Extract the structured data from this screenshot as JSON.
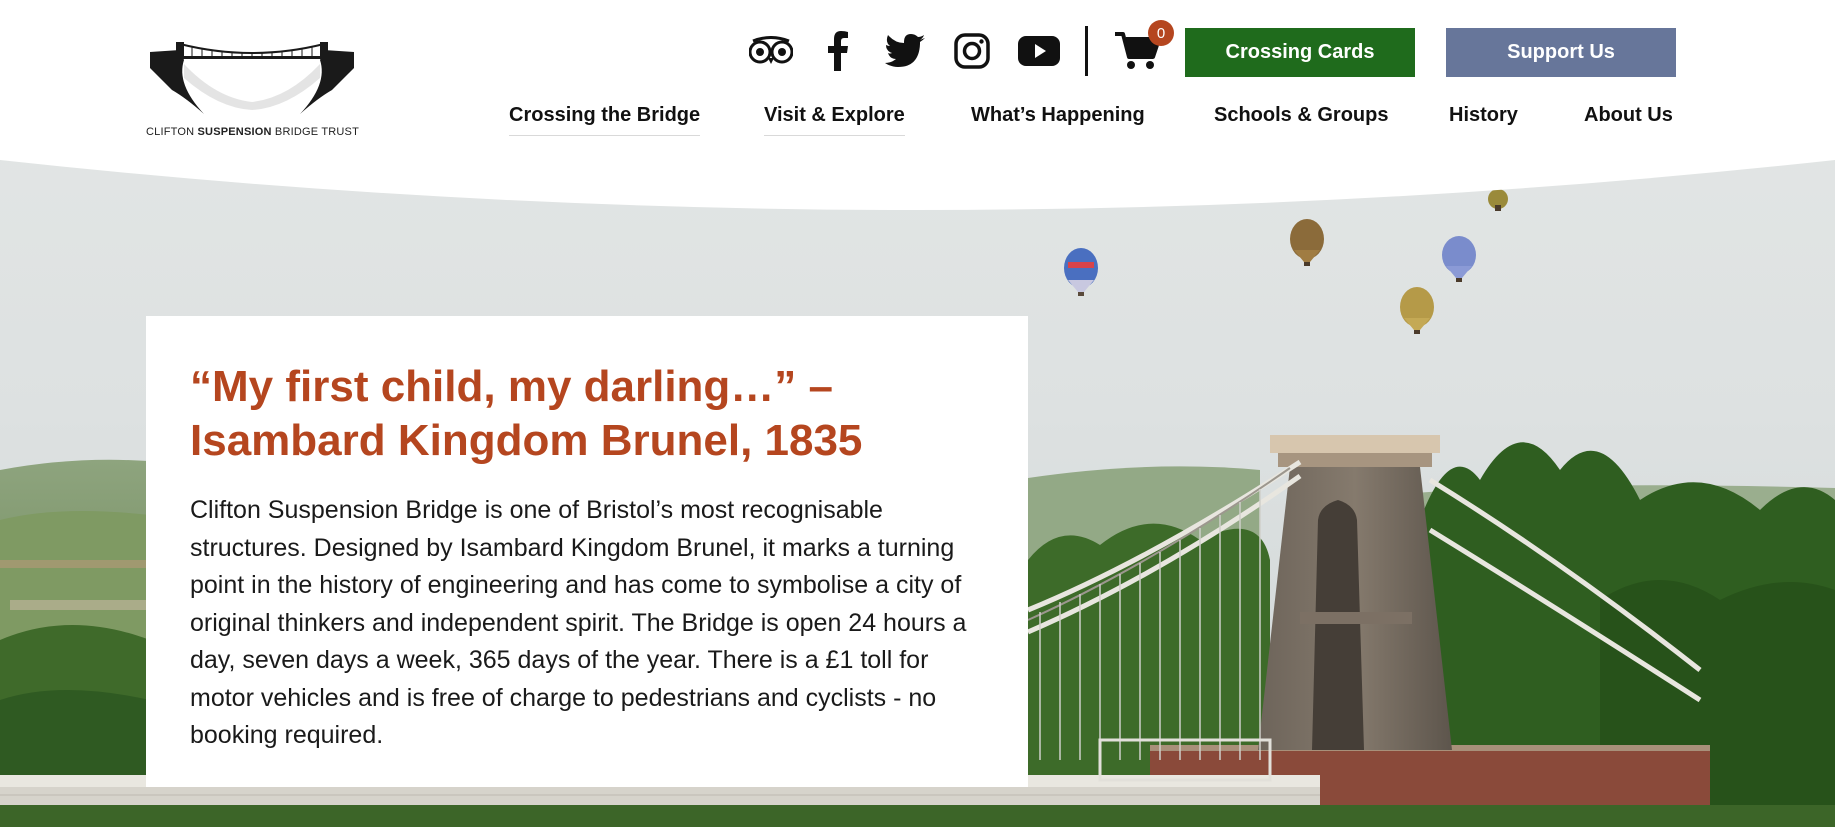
{
  "logo": {
    "text_pre": "CLIFTON ",
    "text_bold": "SUSPENSION",
    "text_post": " BRIDGE TRUST"
  },
  "social": [
    {
      "name": "tripadvisor-icon"
    },
    {
      "name": "facebook-icon"
    },
    {
      "name": "twitter-icon"
    },
    {
      "name": "instagram-icon"
    },
    {
      "name": "youtube-icon"
    }
  ],
  "cart": {
    "count": "0"
  },
  "buttons": {
    "crossing_cards": "Crossing Cards",
    "support_us": "Support Us"
  },
  "nav": [
    {
      "label": "Crossing the Bridge"
    },
    {
      "label": "Visit & Explore"
    },
    {
      "label": "What’s Happening"
    },
    {
      "label": "Schools & Groups"
    },
    {
      "label": "History"
    },
    {
      "label": "About Us"
    }
  ],
  "hero": {
    "heading": "“My first child, my darling…” – Isambard Kingdom Brunel, 1835",
    "body": "Clifton Suspension Bridge is one of Bristol’s most recognisable structures. Designed by Isambard Kingdom Brunel, it marks a turning point in the history of engineering and has come to symbolise a city of original thinkers and independent spirit. The Bridge is open 24 hours a day, seven days a week, 365 days of the year. There is a £1 toll for motor vehicles and is free of charge to pedestrians and cyclists - no booking required."
  },
  "colors": {
    "accent": "#b5461f",
    "cards_button": "#1f6b1c",
    "support_button": "#67769a"
  }
}
